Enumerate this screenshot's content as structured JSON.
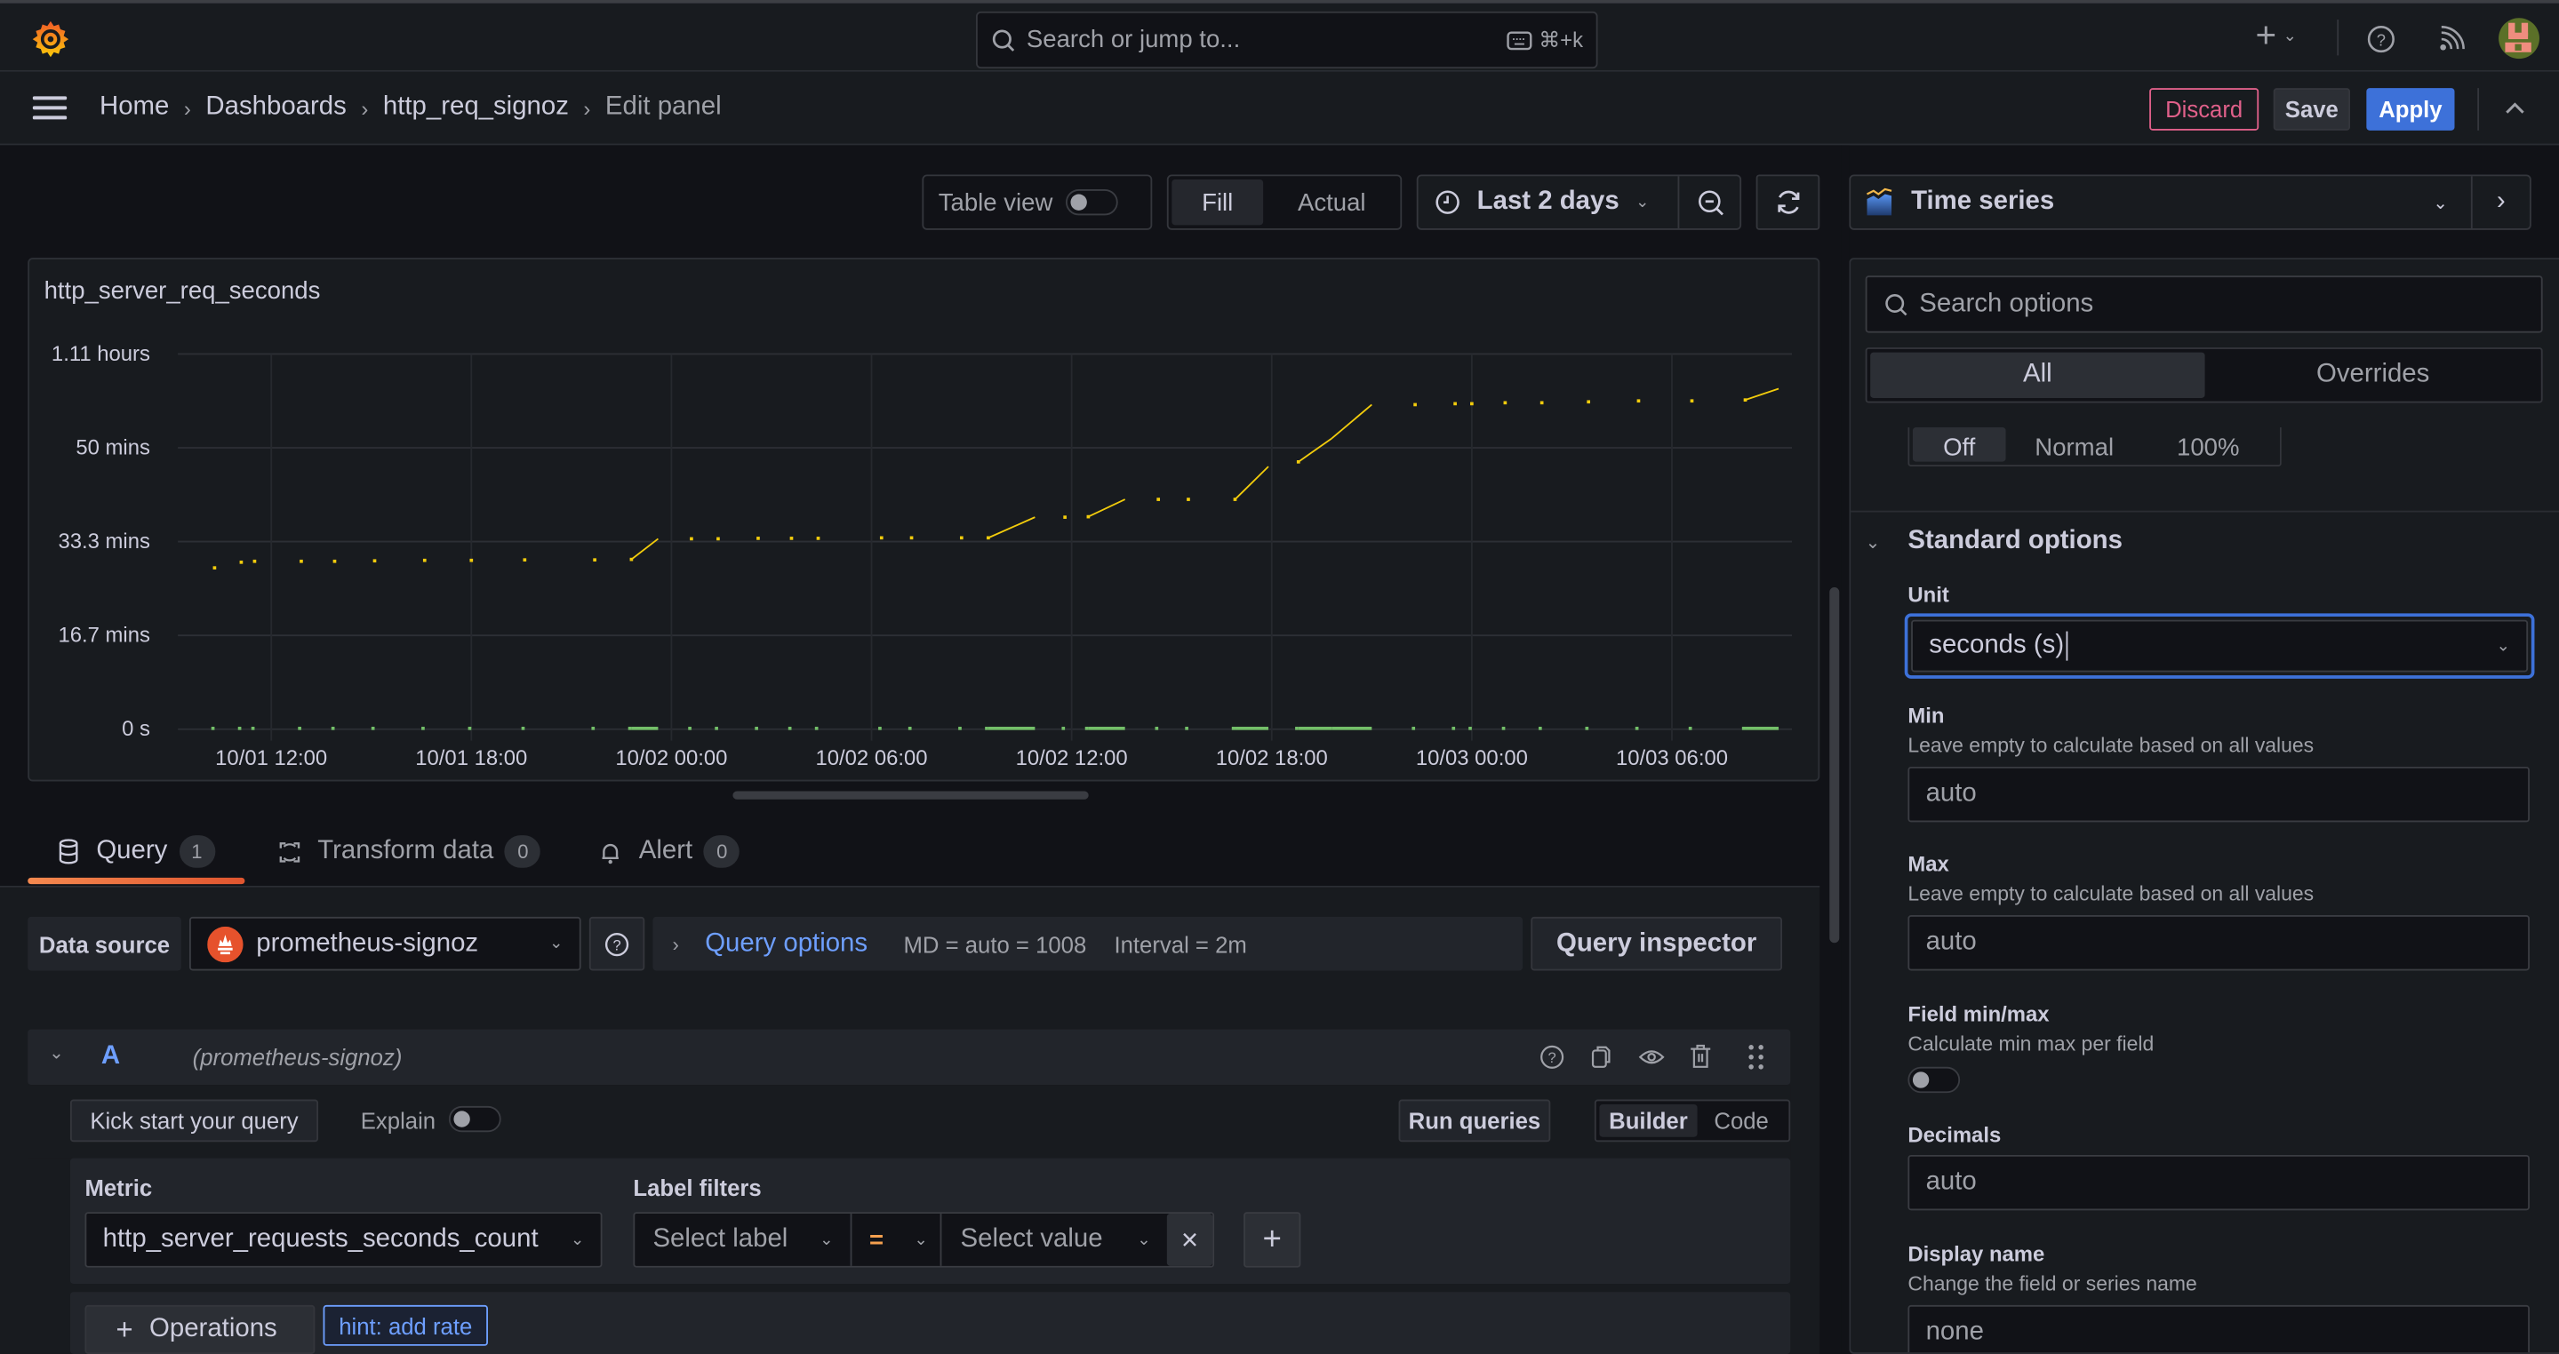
{
  "topbar": {
    "search_placeholder": "Search or jump to...",
    "search_shortcut": "⌘+k",
    "new_label": "+",
    "icons": [
      "grafana-logo-icon",
      "search-icon",
      "keyboard-icon",
      "plus-icon",
      "chevron-down-icon",
      "help-icon",
      "news-rss-icon",
      "user-avatar"
    ]
  },
  "breadcrumb": {
    "items": [
      "Home",
      "Dashboards",
      "http_req_signoz",
      "Edit panel"
    ],
    "separator": "›"
  },
  "actions": {
    "discard": "Discard",
    "save": "Save",
    "apply": "Apply",
    "colors": {
      "discard": "#e0608a",
      "apply": "#3d71d9"
    }
  },
  "viz_toolbar": {
    "table_view": "Table view",
    "table_view_on": false,
    "fill": "Fill",
    "actual": "Actual",
    "fill_selected": true,
    "time_range": "Last 2 days"
  },
  "viz_picker": {
    "label": "Time series"
  },
  "panel": {
    "title": "http_server_req_seconds"
  },
  "chart_data": {
    "type": "line",
    "title": "http_server_req_seconds",
    "xlabel": "",
    "ylabel": "",
    "x_ticks": [
      "10/01 12:00",
      "10/01 18:00",
      "10/02 00:00",
      "10/02 06:00",
      "10/02 12:00",
      "10/02 18:00",
      "10/03 00:00",
      "10/03 06:00"
    ],
    "y_ticks": [
      "0 s",
      "16.7 mins",
      "33.3 mins",
      "50 mins",
      "1.11 hours"
    ],
    "ylim_seconds": [
      0,
      4000
    ],
    "xlim_hours_from_10_01_00": [
      9.2,
      33.4
    ],
    "grid": true,
    "legend": "none",
    "series": [
      {
        "name": "series-yellow",
        "color": "#f2cc0c",
        "x_hours": [
          10.3,
          11.1,
          11.5,
          12.9,
          13.9,
          15.1,
          16.6,
          18.0,
          19.6,
          21.7,
          22.8,
          23.6,
          24.6,
          25.4,
          26.6,
          27.6,
          28.4,
          30.3,
          31.2,
          32.7,
          33.5,
          34.9,
          35.8,
          36.5,
          37.6,
          38.6,
          39.5,
          40.9,
          41.9,
          42.8,
          43.8,
          45.0,
          46.3,
          47.5,
          48.0,
          49.0,
          50.1,
          51.5,
          53.0,
          54.6,
          56.2,
          57.2
        ],
        "values_seconds": [
          1720,
          1780,
          1790,
          1790,
          1790,
          1795,
          1800,
          1800,
          1805,
          1805,
          1810,
          2030,
          2030,
          2030,
          2035,
          2035,
          2035,
          2040,
          2040,
          2040,
          2040,
          2260,
          2260,
          2265,
          2450,
          2450,
          2450,
          2450,
          2800,
          2850,
          3100,
          3460,
          3460,
          3470,
          3470,
          3480,
          3480,
          3490,
          3500,
          3500,
          3510,
          3630
        ],
        "style": "sparse-dots-with-ramps"
      },
      {
        "name": "series-green",
        "color": "#73bf69",
        "note": "near-zero values along baseline",
        "values_seconds": [
          0
        ]
      }
    ]
  },
  "query_tabs": [
    {
      "label": "Query",
      "count": "1",
      "active": true
    },
    {
      "label": "Transform data",
      "count": "0",
      "active": false
    },
    {
      "label": "Alert",
      "count": "0",
      "active": false
    }
  ],
  "query_bar": {
    "data_source_label": "Data source",
    "data_source": "prometheus-signoz",
    "query_options": "Query options",
    "md": "MD = auto = 1008",
    "interval": "Interval = 2m",
    "query_inspector": "Query inspector"
  },
  "query_row": {
    "ref_id": "A",
    "datasource_hint": "(prometheus-signoz)",
    "kick_start": "Kick start your query",
    "explain": "Explain",
    "explain_on": false,
    "run_queries": "Run queries",
    "builder": "Builder",
    "code": "Code",
    "mode_selected": "Builder",
    "metric_label": "Metric",
    "metric_value": "http_server_requests_seconds_count",
    "label_filters_label": "Label filters",
    "select_label_placeholder": "Select label",
    "operator": "=",
    "select_value_placeholder": "Select value",
    "remove": "×",
    "add": "+",
    "operations": "Operations",
    "hint": "hint: add rate"
  },
  "options_pane": {
    "search_placeholder": "Search options",
    "tabs": [
      "All",
      "Overrides"
    ],
    "active_tab": "All",
    "stacking": {
      "options": [
        "Off",
        "Normal",
        "100%"
      ],
      "selected": "Off"
    },
    "standard_options_title": "Standard options",
    "unit": {
      "label": "Unit",
      "value": "seconds (s)"
    },
    "min": {
      "label": "Min",
      "description": "Leave empty to calculate based on all values",
      "placeholder": "auto"
    },
    "max": {
      "label": "Max",
      "description": "Leave empty to calculate based on all values",
      "placeholder": "auto"
    },
    "field_minmax": {
      "label": "Field min/max",
      "description": "Calculate min max per field",
      "on": false
    },
    "decimals": {
      "label": "Decimals",
      "placeholder": "auto"
    },
    "display_name": {
      "label": "Display name",
      "description": "Change the field or series name",
      "placeholder": "none"
    }
  }
}
